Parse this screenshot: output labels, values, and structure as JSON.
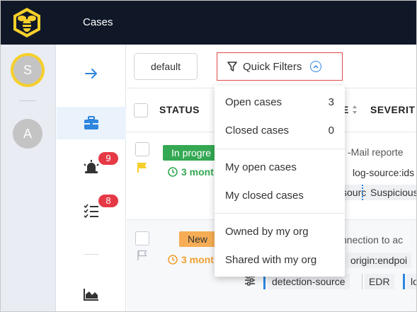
{
  "header": {
    "title": "Cases"
  },
  "users": {
    "current": "S",
    "secondary": "A"
  },
  "nav": {
    "alerts_count": "9",
    "tasks_count": "8"
  },
  "toolbar": {
    "default_label": "default",
    "quick_filters_label": "Quick Filters"
  },
  "table": {
    "columns": {
      "status": "STATUS",
      "type_partial": "E",
      "severity": "SEVERIT"
    },
    "rows": [
      {
        "status": "In progre",
        "age": "3 mont",
        "title_partial": "-Mail reporte",
        "tags": [
          "log-source:ids",
          "source",
          "Suspicious"
        ]
      },
      {
        "status": "New",
        "age": "3 mont",
        "title_partial": "nnection to ac",
        "tags": [
          "origin:endpoi"
        ],
        "observables": [
          "detection-source",
          "EDR",
          "lo"
        ]
      }
    ]
  },
  "quick_filters_menu": {
    "groups": [
      [
        {
          "label": "Open cases",
          "count": "3"
        },
        {
          "label": "Closed cases",
          "count": "0"
        }
      ],
      [
        {
          "label": "My open cases"
        },
        {
          "label": "My closed cases"
        }
      ],
      [
        {
          "label": "Owned by my org"
        },
        {
          "label": "Shared with my org"
        }
      ]
    ]
  },
  "colors": {
    "header_bg": "#101828",
    "accent_blue": "#2e86de",
    "logo_yellow": "#f6cf2a",
    "badge_red": "#e63946",
    "status_in_progress": "#34a853",
    "status_new": "#f6ad55",
    "highlight_border": "#e24b4b"
  },
  "icons": {
    "logo": "bee-logo-icon",
    "expand": "arrow-right-icon",
    "cases": "briefcase-icon",
    "alerts": "siren-icon",
    "tasks": "checklist-icon",
    "dashboards": "area-chart-icon",
    "filter": "filter-icon",
    "chevron": "chevron-up-circle-icon",
    "flag": "flag-icon",
    "clock": "clock-icon",
    "observables": "sliders-icon"
  }
}
